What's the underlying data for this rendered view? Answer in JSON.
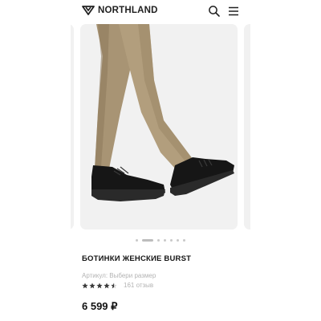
{
  "header": {
    "brand": "NORTHLAND",
    "icons": [
      "northland-logo-icon",
      "search-icon",
      "hamburger-menu-icon"
    ]
  },
  "gallery": {
    "slides_total": 7,
    "active_slide": 2
  },
  "product": {
    "title": "БОТИНКИ ЖЕНСКИЕ BURST",
    "sku_label": "Артикул: Выбери размер",
    "rating": 4.5,
    "rating_max": 5,
    "reviews_label": "161 отзыв",
    "price": "6 599 ₽"
  },
  "colors": {
    "text": "#151515",
    "muted": "#b3b3b3",
    "slide_bg": "#f1f1f1",
    "trousers": "#a89474",
    "shoe": "#161616"
  }
}
